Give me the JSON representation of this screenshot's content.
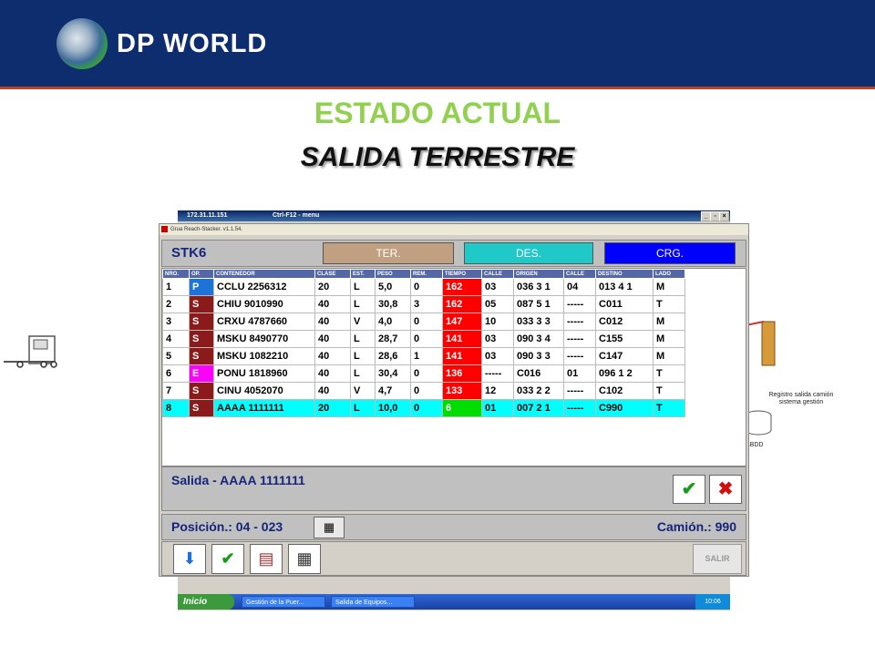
{
  "brand": {
    "name": "DP WORLD"
  },
  "slide": {
    "title": "ESTADO ACTUAL",
    "subtitle": "SALIDA TERRESTRE"
  },
  "diagram": {
    "register_label": "Registro salida camión sistema gestión",
    "db_label": "BBDD"
  },
  "outer_window": {
    "title_ip": "172.31.11.151",
    "title_menu": "Ctrl-F12 - menu"
  },
  "app_window": {
    "title": "Grua Reach-Stacker. v1.1.54."
  },
  "app": {
    "machine": "STK6",
    "tabs": [
      {
        "label": "TER.",
        "color": "#c0a080"
      },
      {
        "label": "DES.",
        "color": "#20c8c8"
      },
      {
        "label": "CRG.",
        "color": "#0000ff"
      }
    ],
    "columns": [
      "NRO.",
      "OP.",
      "CONTENEDOR",
      "CLASE",
      "EST.",
      "PESO",
      "REM.",
      "TIEMPO",
      "CALLE",
      "ORIGEN",
      "CALLE",
      "DESTINO",
      "LADO"
    ],
    "rows": [
      {
        "nro": "1",
        "op": "P",
        "op_color": "#1e73d8",
        "cont": "CCLU 2256312",
        "clase": "20",
        "est": "L",
        "peso": "5,0",
        "rem": "0",
        "tiempo": "162",
        "t_color": "#ff0000",
        "calle": "03",
        "origen": "036 3 1",
        "calle2": "04",
        "destino": "013 4 1",
        "lado": "M"
      },
      {
        "nro": "2",
        "op": "S",
        "op_color": "#8b1a1a",
        "cont": "CHIU 9010990",
        "clase": "40",
        "est": "L",
        "peso": "30,8",
        "rem": "3",
        "tiempo": "162",
        "t_color": "#ff0000",
        "calle": "05",
        "origen": "087 5 1",
        "calle2": "-----",
        "destino": "C011",
        "lado": "T"
      },
      {
        "nro": "3",
        "op": "S",
        "op_color": "#8b1a1a",
        "cont": "CRXU 4787660",
        "clase": "40",
        "est": "V",
        "peso": "4,0",
        "rem": "0",
        "tiempo": "147",
        "t_color": "#ff0000",
        "calle": "10",
        "origen": "033 3 3",
        "calle2": "-----",
        "destino": "C012",
        "lado": "M"
      },
      {
        "nro": "4",
        "op": "S",
        "op_color": "#8b1a1a",
        "cont": "MSKU 8490770",
        "clase": "40",
        "est": "L",
        "peso": "28,7",
        "rem": "0",
        "tiempo": "141",
        "t_color": "#ff0000",
        "calle": "03",
        "origen": "090 3 4",
        "calle2": "-----",
        "destino": "C155",
        "lado": "M"
      },
      {
        "nro": "5",
        "op": "S",
        "op_color": "#8b1a1a",
        "cont": "MSKU 1082210",
        "clase": "40",
        "est": "L",
        "peso": "28,6",
        "rem": "1",
        "tiempo": "141",
        "t_color": "#ff0000",
        "calle": "03",
        "origen": "090 3 3",
        "calle2": "-----",
        "destino": "C147",
        "lado": "M"
      },
      {
        "nro": "6",
        "op": "E",
        "op_color": "#ff00ff",
        "cont": "PONU 1818960",
        "clase": "40",
        "est": "L",
        "peso": "30,4",
        "rem": "0",
        "tiempo": "136",
        "t_color": "#ff0000",
        "calle": "-----",
        "origen": "C016",
        "calle2": "01",
        "destino": "096 1 2",
        "lado": "T"
      },
      {
        "nro": "7",
        "op": "S",
        "op_color": "#8b1a1a",
        "cont": "CINU 4052070",
        "clase": "40",
        "est": "V",
        "peso": "4,7",
        "rem": "0",
        "tiempo": "133",
        "t_color": "#ff0000",
        "calle": "12",
        "origen": "033 2 2",
        "calle2": "-----",
        "destino": "C102",
        "lado": "T"
      },
      {
        "nro": "8",
        "op": "S",
        "op_color": "#8b1a1a",
        "cont": "AAAA 1111111",
        "clase": "20",
        "est": "L",
        "peso": "10,0",
        "rem": "0",
        "tiempo": "6",
        "t_color": "#00dd00",
        "calle": "01",
        "origen": "007 2 1",
        "calle2": "-----",
        "destino": "C990",
        "lado": "T",
        "selected": true
      }
    ],
    "salida_text": "Salida - AAAA 1111111",
    "posicion_text": "Posición.: 04 - 023",
    "camion_text": "Camión.: 990",
    "salir_label": "SALIR"
  },
  "taskbar": {
    "start_label": "Inicio",
    "tasks": [
      "Gestión de la Puer...",
      "Salida de Equipos..."
    ],
    "clock": "10:06"
  }
}
